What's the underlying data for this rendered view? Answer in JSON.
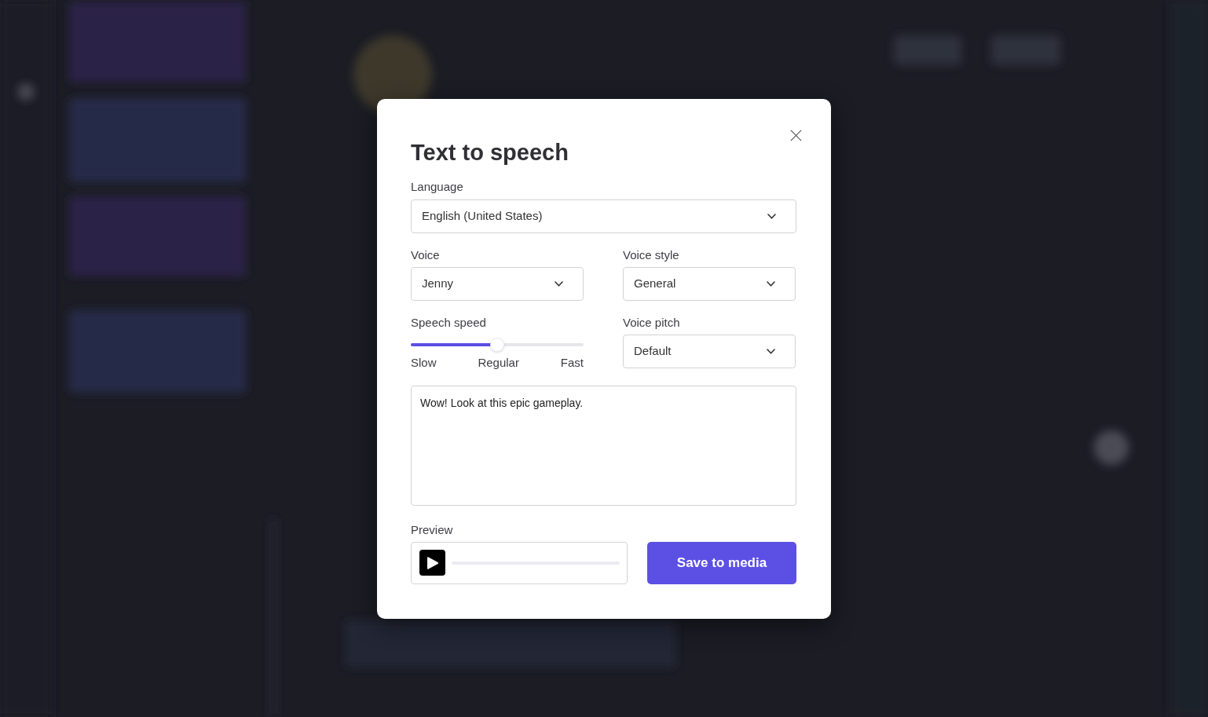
{
  "dialog": {
    "title": "Text to speech",
    "language": {
      "label": "Language",
      "value": "English (United States)"
    },
    "voice": {
      "label": "Voice",
      "value": "Jenny"
    },
    "voice_style": {
      "label": "Voice style",
      "value": "General"
    },
    "speech_speed": {
      "label": "Speech speed",
      "level": 0.5,
      "scale_labels": [
        "Slow",
        "Regular",
        "Fast"
      ]
    },
    "voice_pitch": {
      "label": "Voice pitch",
      "value": "Default"
    },
    "script": {
      "value": "Wow! Look at this epic gameplay."
    },
    "preview": {
      "label": "Preview"
    },
    "buttons": [
      "Save to media"
    ]
  }
}
